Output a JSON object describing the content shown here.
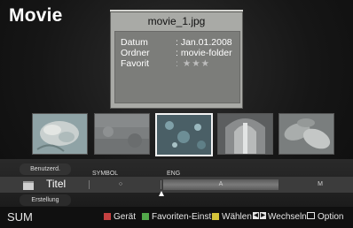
{
  "page": {
    "title": "Movie"
  },
  "info": {
    "filename": "movie_1.jpg",
    "rows": [
      {
        "key": "Datum",
        "value": ": Jan.01.2008"
      },
      {
        "key": "Ordner",
        "value": ": movie-folder"
      },
      {
        "key": "Favorit",
        "value": ": ★★★"
      }
    ]
  },
  "thumbnails": [
    {
      "name": "flower-thumbnail",
      "selected": false
    },
    {
      "name": "grey-texture-thumbnail",
      "selected": false
    },
    {
      "name": "bubbles-thumbnail",
      "selected": true
    },
    {
      "name": "cathedral-thumbnail",
      "selected": false
    },
    {
      "name": "leaves-thumbnail",
      "selected": false
    }
  ],
  "sort": {
    "above_label": "Benutzerd.",
    "current_label": "Titel",
    "below_label": "Erstellung",
    "columns": [
      "SYMBOL",
      "ENG"
    ],
    "segments": [
      "○",
      "A",
      "M"
    ],
    "active_segment": "A"
  },
  "footer": {
    "left_label": "SUM",
    "colors": {
      "red": "#c44040",
      "green": "#52a84a",
      "yellow": "#d4c43a",
      "blue": "#4a6fc7"
    },
    "items": [
      {
        "label": "Gerät",
        "color_key": "red"
      },
      {
        "label": "Favoriten-Einst",
        "color_key": "green"
      },
      {
        "label": "Wählen",
        "color_key": "yellow"
      },
      {
        "label": "Wechseln",
        "icon": "skip-icons"
      },
      {
        "label": "Option",
        "icon": "tools-icon"
      }
    ]
  }
}
